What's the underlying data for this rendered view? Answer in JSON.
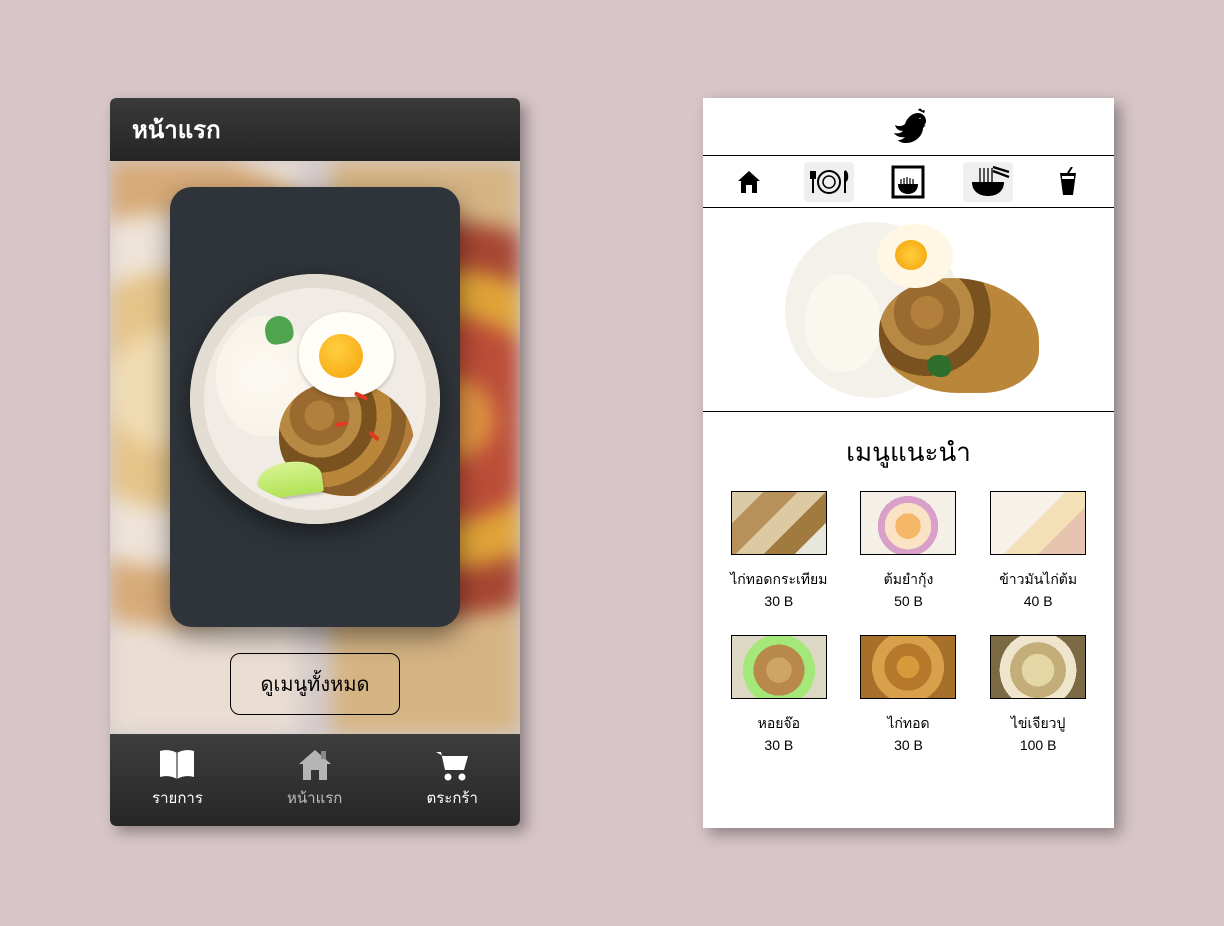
{
  "left": {
    "header_title": "หน้าแรก",
    "view_all_label": "ดูเมนูทั้งหมด",
    "nav": {
      "list": "รายการ",
      "home": "หน้าแรก",
      "cart": "ตระกร้า"
    }
  },
  "right": {
    "recommended_title": "เมนูแนะนำ",
    "items": [
      {
        "name": "ไก่ทอดกระเทียม",
        "price": "30 B"
      },
      {
        "name": "ต้มยำกุ้ง",
        "price": "50 B"
      },
      {
        "name": "ข้าวมันไก่ต้ม",
        "price": "40 B"
      },
      {
        "name": "หอยจ๊อ",
        "price": "30 B"
      },
      {
        "name": "ไก่ทอด",
        "price": "30 B"
      },
      {
        "name": "ไข่เจียวปู",
        "price": "100 B"
      }
    ]
  }
}
